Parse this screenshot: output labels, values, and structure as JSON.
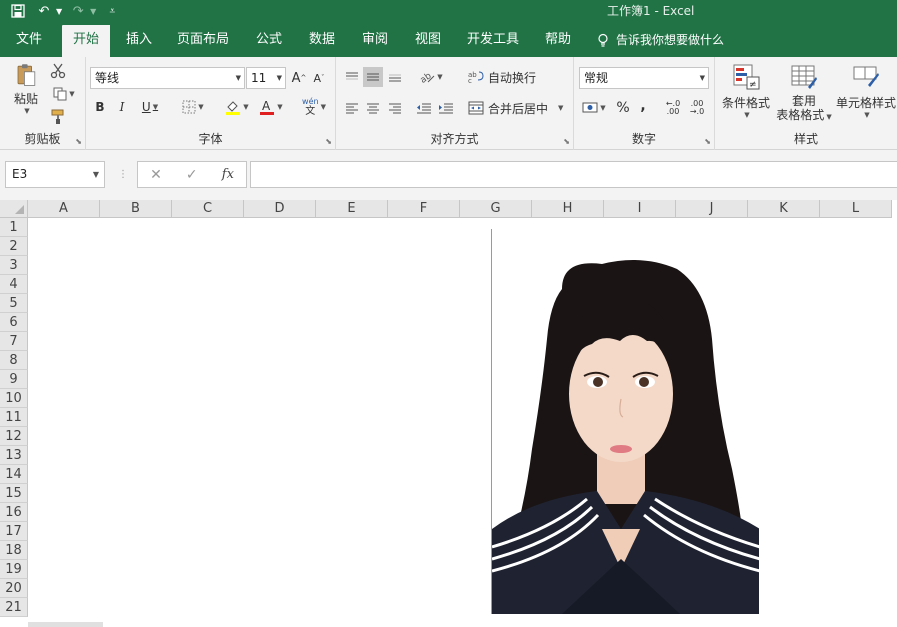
{
  "window": {
    "title": "工作簿1  -  Excel"
  },
  "tabs": [
    {
      "label": "文件"
    },
    {
      "label": "开始"
    },
    {
      "label": "插入"
    },
    {
      "label": "页面布局"
    },
    {
      "label": "公式"
    },
    {
      "label": "数据"
    },
    {
      "label": "审阅"
    },
    {
      "label": "视图"
    },
    {
      "label": "开发工具"
    },
    {
      "label": "帮助"
    }
  ],
  "tell_me": "告诉我你想要做什么",
  "ribbon": {
    "clipboard": {
      "label": "剪贴板",
      "paste": "粘贴"
    },
    "font": {
      "label": "字体",
      "name": "等线",
      "size": "11",
      "phonetic_top": "wén",
      "phonetic_bottom": "文"
    },
    "alignment": {
      "label": "对齐方式",
      "wrap": "自动换行",
      "merge": "合并后居中"
    },
    "number": {
      "label": "数字",
      "format": "常规"
    },
    "styles": {
      "label": "样式",
      "conditional": "条件格式",
      "table_top": "套用",
      "table_bottom": "表格格式",
      "cell_styles": "单元格样式"
    }
  },
  "formula_bar": {
    "name_box": "E3",
    "formula": ""
  },
  "columns": [
    "A",
    "B",
    "C",
    "D",
    "E",
    "F",
    "G",
    "H",
    "I",
    "J",
    "K",
    "L"
  ],
  "rows": [
    "1",
    "2",
    "3",
    "4",
    "5",
    "6",
    "7",
    "8",
    "9",
    "10",
    "11",
    "12",
    "13",
    "14",
    "15",
    "16",
    "17",
    "18",
    "19",
    "20",
    "21"
  ],
  "colors": {
    "brand": "#217346",
    "ribbon_bg": "#f3f3f3",
    "header_bg": "#e6e6e6"
  }
}
